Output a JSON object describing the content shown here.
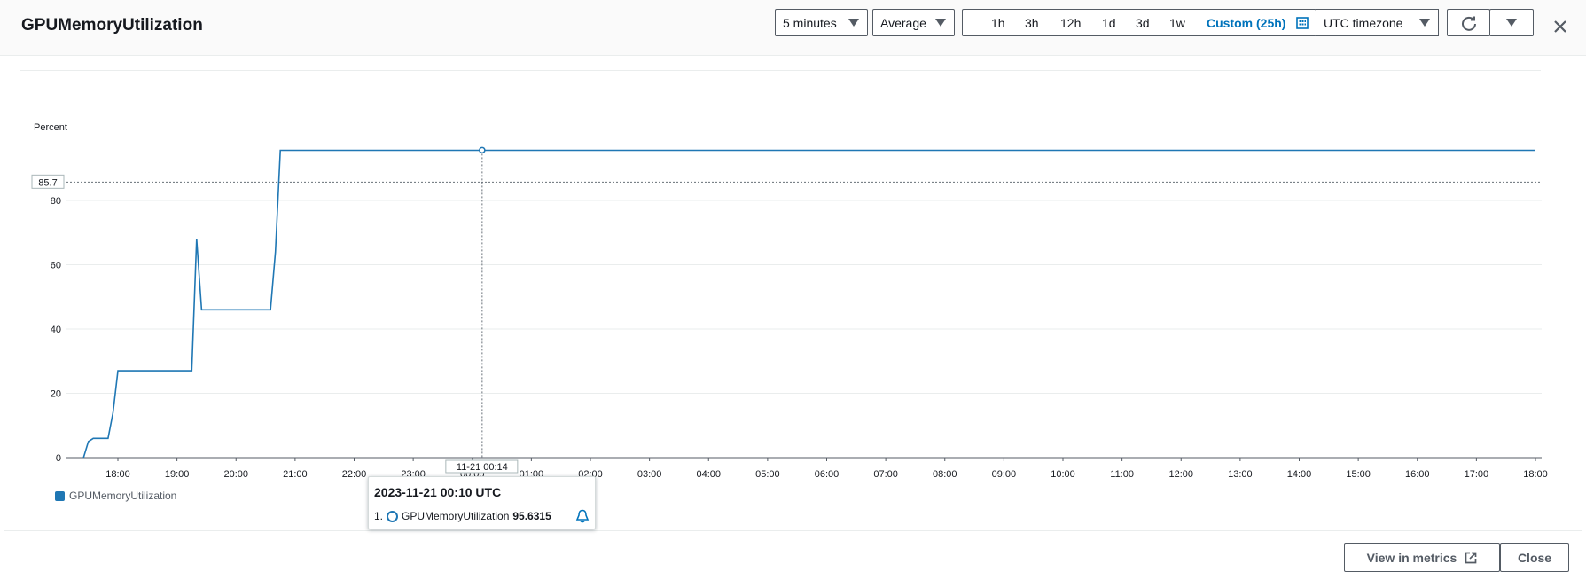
{
  "header": {
    "title": "GPUMemoryUtilization",
    "period": "5 minutes",
    "statistic": "Average",
    "ranges": [
      "1h",
      "3h",
      "12h",
      "1d",
      "3d",
      "1w"
    ],
    "custom_range": "Custom (25h)",
    "timezone": "UTC timezone"
  },
  "footer": {
    "view_in_metrics": "View in metrics",
    "close": "Close"
  },
  "tooltip": {
    "title": "2023-11-21 00:10 UTC",
    "index": "1.",
    "series": "GPUMemoryUtilization",
    "value": "95.6315"
  },
  "crosshair": {
    "time_label": "11-21 00:14",
    "y_label": "85.7"
  },
  "colors": {
    "series": "#1f77b4",
    "accent": "#0073bb"
  },
  "chart_data": {
    "type": "line",
    "ylabel": "Percent",
    "xlabel": "",
    "ylim": [
      0,
      100
    ],
    "yticks": [
      0,
      20,
      40,
      60,
      80
    ],
    "xticks": [
      "18:00",
      "19:00",
      "20:00",
      "21:00",
      "22:00",
      "23:00",
      "00:00",
      "01:00",
      "02:00",
      "03:00",
      "04:00",
      "05:00",
      "06:00",
      "07:00",
      "08:00",
      "09:00",
      "10:00",
      "11:00",
      "12:00",
      "13:00",
      "14:00",
      "15:00",
      "16:00",
      "17:00",
      "18:00"
    ],
    "x_unit": "hours since 18:00 (2023-11-20)",
    "xlim": [
      -0.6,
      24
    ],
    "grid": true,
    "legend": "bottom-left",
    "horizontal_line": 85.7,
    "series": [
      {
        "name": "GPUMemoryUtilization",
        "x": [
          -0.583,
          -0.5,
          -0.417,
          -0.333,
          -0.25,
          -0.167,
          -0.083,
          0.0,
          0.083,
          0.167,
          1.25,
          1.333,
          1.417,
          1.5,
          2.583,
          2.667,
          2.75,
          2.833,
          3.0,
          4.0,
          5.0,
          6.0,
          7.0,
          8.0,
          9.0,
          10.0,
          11.0,
          12.0,
          13.0,
          14.0,
          15.0,
          16.0,
          17.0,
          18.0,
          19.0,
          20.0,
          21.0,
          22.0,
          23.0,
          24.0
        ],
        "y": [
          0,
          5,
          6,
          6,
          6,
          6,
          14,
          27,
          27,
          27,
          27,
          68,
          46,
          46,
          46,
          64,
          95.6,
          95.6,
          95.6,
          95.6,
          95.6,
          95.6,
          95.6,
          95.6,
          95.6,
          95.6,
          95.6,
          95.6,
          95.6,
          95.6,
          95.6,
          95.6,
          95.6,
          95.6,
          95.6,
          95.6,
          95.6,
          95.6,
          95.6,
          95.6
        ]
      }
    ]
  }
}
